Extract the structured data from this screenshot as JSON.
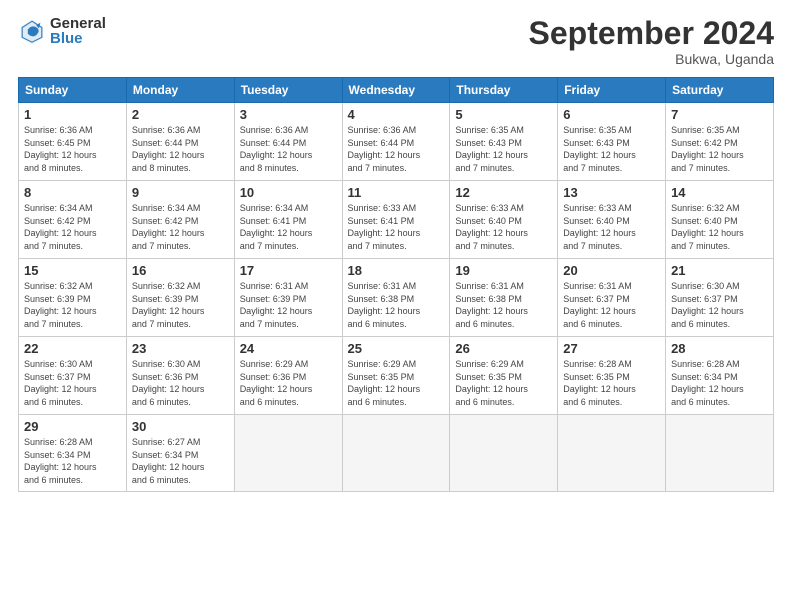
{
  "logo": {
    "general": "General",
    "blue": "Blue"
  },
  "header": {
    "month": "September 2024",
    "location": "Bukwa, Uganda"
  },
  "weekdays": [
    "Sunday",
    "Monday",
    "Tuesday",
    "Wednesday",
    "Thursday",
    "Friday",
    "Saturday"
  ],
  "weeks": [
    [
      {
        "day": "1",
        "info": "Sunrise: 6:36 AM\nSunset: 6:45 PM\nDaylight: 12 hours\nand 8 minutes."
      },
      {
        "day": "2",
        "info": "Sunrise: 6:36 AM\nSunset: 6:44 PM\nDaylight: 12 hours\nand 8 minutes."
      },
      {
        "day": "3",
        "info": "Sunrise: 6:36 AM\nSunset: 6:44 PM\nDaylight: 12 hours\nand 8 minutes."
      },
      {
        "day": "4",
        "info": "Sunrise: 6:36 AM\nSunset: 6:44 PM\nDaylight: 12 hours\nand 7 minutes."
      },
      {
        "day": "5",
        "info": "Sunrise: 6:35 AM\nSunset: 6:43 PM\nDaylight: 12 hours\nand 7 minutes."
      },
      {
        "day": "6",
        "info": "Sunrise: 6:35 AM\nSunset: 6:43 PM\nDaylight: 12 hours\nand 7 minutes."
      },
      {
        "day": "7",
        "info": "Sunrise: 6:35 AM\nSunset: 6:42 PM\nDaylight: 12 hours\nand 7 minutes."
      }
    ],
    [
      {
        "day": "8",
        "info": "Sunrise: 6:34 AM\nSunset: 6:42 PM\nDaylight: 12 hours\nand 7 minutes."
      },
      {
        "day": "9",
        "info": "Sunrise: 6:34 AM\nSunset: 6:42 PM\nDaylight: 12 hours\nand 7 minutes."
      },
      {
        "day": "10",
        "info": "Sunrise: 6:34 AM\nSunset: 6:41 PM\nDaylight: 12 hours\nand 7 minutes."
      },
      {
        "day": "11",
        "info": "Sunrise: 6:33 AM\nSunset: 6:41 PM\nDaylight: 12 hours\nand 7 minutes."
      },
      {
        "day": "12",
        "info": "Sunrise: 6:33 AM\nSunset: 6:40 PM\nDaylight: 12 hours\nand 7 minutes."
      },
      {
        "day": "13",
        "info": "Sunrise: 6:33 AM\nSunset: 6:40 PM\nDaylight: 12 hours\nand 7 minutes."
      },
      {
        "day": "14",
        "info": "Sunrise: 6:32 AM\nSunset: 6:40 PM\nDaylight: 12 hours\nand 7 minutes."
      }
    ],
    [
      {
        "day": "15",
        "info": "Sunrise: 6:32 AM\nSunset: 6:39 PM\nDaylight: 12 hours\nand 7 minutes."
      },
      {
        "day": "16",
        "info": "Sunrise: 6:32 AM\nSunset: 6:39 PM\nDaylight: 12 hours\nand 7 minutes."
      },
      {
        "day": "17",
        "info": "Sunrise: 6:31 AM\nSunset: 6:39 PM\nDaylight: 12 hours\nand 7 minutes."
      },
      {
        "day": "18",
        "info": "Sunrise: 6:31 AM\nSunset: 6:38 PM\nDaylight: 12 hours\nand 6 minutes."
      },
      {
        "day": "19",
        "info": "Sunrise: 6:31 AM\nSunset: 6:38 PM\nDaylight: 12 hours\nand 6 minutes."
      },
      {
        "day": "20",
        "info": "Sunrise: 6:31 AM\nSunset: 6:37 PM\nDaylight: 12 hours\nand 6 minutes."
      },
      {
        "day": "21",
        "info": "Sunrise: 6:30 AM\nSunset: 6:37 PM\nDaylight: 12 hours\nand 6 minutes."
      }
    ],
    [
      {
        "day": "22",
        "info": "Sunrise: 6:30 AM\nSunset: 6:37 PM\nDaylight: 12 hours\nand 6 minutes."
      },
      {
        "day": "23",
        "info": "Sunrise: 6:30 AM\nSunset: 6:36 PM\nDaylight: 12 hours\nand 6 minutes."
      },
      {
        "day": "24",
        "info": "Sunrise: 6:29 AM\nSunset: 6:36 PM\nDaylight: 12 hours\nand 6 minutes."
      },
      {
        "day": "25",
        "info": "Sunrise: 6:29 AM\nSunset: 6:35 PM\nDaylight: 12 hours\nand 6 minutes."
      },
      {
        "day": "26",
        "info": "Sunrise: 6:29 AM\nSunset: 6:35 PM\nDaylight: 12 hours\nand 6 minutes."
      },
      {
        "day": "27",
        "info": "Sunrise: 6:28 AM\nSunset: 6:35 PM\nDaylight: 12 hours\nand 6 minutes."
      },
      {
        "day": "28",
        "info": "Sunrise: 6:28 AM\nSunset: 6:34 PM\nDaylight: 12 hours\nand 6 minutes."
      }
    ],
    [
      {
        "day": "29",
        "info": "Sunrise: 6:28 AM\nSunset: 6:34 PM\nDaylight: 12 hours\nand 6 minutes."
      },
      {
        "day": "30",
        "info": "Sunrise: 6:27 AM\nSunset: 6:34 PM\nDaylight: 12 hours\nand 6 minutes."
      },
      {
        "day": "",
        "info": ""
      },
      {
        "day": "",
        "info": ""
      },
      {
        "day": "",
        "info": ""
      },
      {
        "day": "",
        "info": ""
      },
      {
        "day": "",
        "info": ""
      }
    ]
  ]
}
